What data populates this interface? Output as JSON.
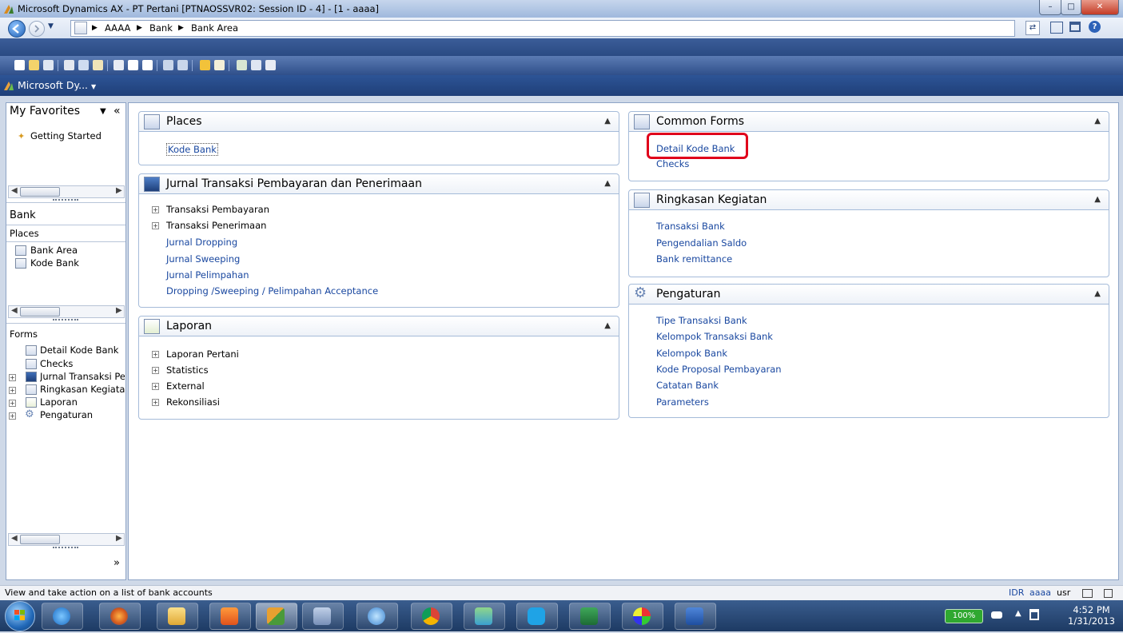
{
  "window": {
    "title": "Microsoft Dynamics AX - PT Pertani [PTNAOSSVR02: Session ID - 4] - [1 - aaaa]"
  },
  "address": {
    "crumbs": [
      "AAAA",
      "Bank",
      "Bank Area"
    ]
  },
  "workspace": {
    "label": "Microsoft Dy..."
  },
  "nav": {
    "favorites_title": "My Favorites",
    "favorites_items": [
      "Getting Started"
    ],
    "module_title": "Bank",
    "places_title": "Places",
    "places_items": [
      "Bank Area",
      "Kode Bank"
    ],
    "forms_title": "Forms",
    "forms_items": [
      "Detail Kode Bank",
      "Checks",
      "Jurnal Transaksi Per",
      "Ringkasan Kegiatan",
      "Laporan",
      "Pengaturan"
    ]
  },
  "groups": {
    "places": {
      "title": "Places",
      "links": [
        "Kode Bank"
      ]
    },
    "jurnal": {
      "title": "Jurnal Transaksi Pembayaran dan Penerimaan",
      "expandable": [
        "Transaksi Pembayaran",
        "Transaksi Penerimaan"
      ],
      "links": [
        "Jurnal Dropping",
        "Jurnal Sweeping",
        "Jurnal Pelimpahan",
        "Dropping /Sweeping / Pelimpahan Acceptance"
      ]
    },
    "laporan": {
      "title": "Laporan",
      "expandable": [
        "Laporan Pertani",
        "Statistics",
        "External",
        "Rekonsiliasi"
      ]
    },
    "common": {
      "title": "Common Forms",
      "links": [
        "Detail Kode Bank",
        "Checks"
      ]
    },
    "ringkasan": {
      "title": "Ringkasan Kegiatan",
      "links": [
        "Transaksi Bank",
        "Pengendalian Saldo",
        "Bank remittance"
      ]
    },
    "pengaturan": {
      "title": "Pengaturan",
      "links": [
        "Tipe Transaksi Bank",
        "Kelompok Transaksi Bank",
        "Kelompok Bank",
        "Kode Proposal Pembayaran",
        "Catatan Bank",
        "Parameters"
      ]
    }
  },
  "status": {
    "text": "View and take action on a list of bank accounts",
    "currency": "IDR",
    "company": "aaaa",
    "user": "usr"
  },
  "taskbar": {
    "battery": "100%",
    "time": "4:52 PM",
    "date": "1/31/2013"
  },
  "colors": {
    "link": "#1a48a0",
    "highlight": "#e0001b",
    "titlebar": "#9fb8dd",
    "toolbar": "#2f4f8a"
  }
}
